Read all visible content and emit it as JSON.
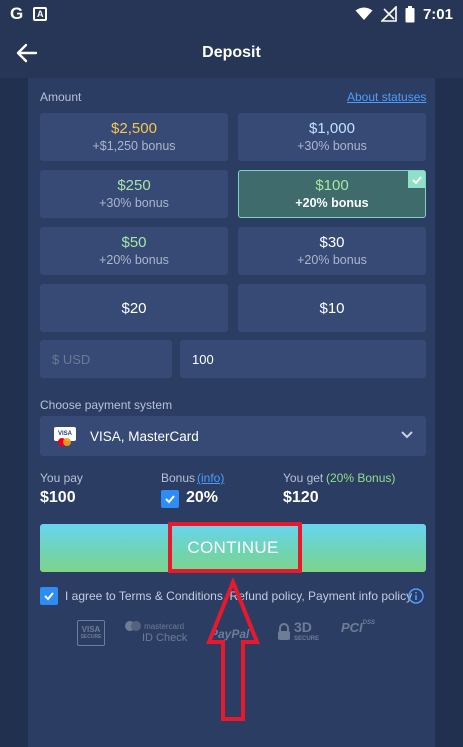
{
  "status_bar": {
    "time": "7:01",
    "left_glyph": "G",
    "notification_glyph": "A"
  },
  "header": {
    "title": "Deposit"
  },
  "amount": {
    "label": "Amount",
    "about_link": "About statuses",
    "tiles": [
      {
        "amount": "$2,500",
        "bonus": "+$1,250 bonus",
        "color": "#f7c650"
      },
      {
        "amount": "$1,000",
        "bonus": "+30% bonus",
        "color": "#bfe4ff"
      },
      {
        "amount": "$250",
        "bonus": "+30% bonus",
        "color": "#a6e6a6"
      },
      {
        "amount": "$100",
        "bonus": "+20% bonus",
        "color": "#a6e6a6",
        "selected": true
      },
      {
        "amount": "$50",
        "bonus": "+20% bonus",
        "color": "#a6e6a6"
      },
      {
        "amount": "$30",
        "bonus": "+20% bonus",
        "color": "#ffffff"
      },
      {
        "amount": "$20",
        "bonus": "",
        "color": "#ffffff"
      },
      {
        "amount": "$10",
        "bonus": "",
        "color": "#ffffff"
      }
    ],
    "currency_placeholder": "$ USD",
    "custom_value": "100"
  },
  "payment": {
    "label": "Choose payment system",
    "selected": "VISA, MasterCard",
    "card_icon_text": "VISA"
  },
  "summary": {
    "you_pay_label": "You pay",
    "you_pay_value": "$100",
    "bonus_label": "Bonus",
    "bonus_info": "(info)",
    "bonus_value": "20%",
    "you_get_label": "You get",
    "you_get_bonus": "(20% Bonus)",
    "you_get_value": "$120"
  },
  "continue_label": "CONTINUE",
  "agree_text": "I agree to Terms & Conditions, Refund policy, Payment info policy",
  "logos": {
    "visa_line1": "VISA",
    "visa_line2": "SECURE",
    "mc_line1": "mastercard",
    "mc_line2": "ID Check",
    "paypal": "PayPal",
    "d3_main": "3D",
    "d3_sub": "SECURE",
    "pci": "PCI",
    "pci_sub": "DSS"
  },
  "colors": {
    "accent_blue": "#2e8cf5",
    "selected_border": "#7ed4c4",
    "annotation_red": "#e8192c"
  }
}
